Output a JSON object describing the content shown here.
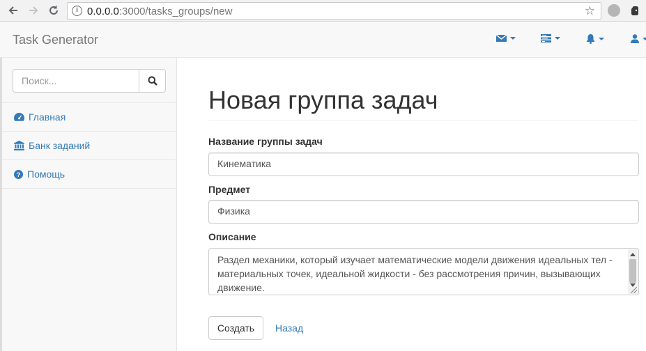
{
  "browser": {
    "url_host": "0.0.0.0",
    "url_rest": ":3000/tasks_groups/new"
  },
  "navbar": {
    "brand": "Task Generator",
    "menus": [
      {
        "icon": "envelope-icon"
      },
      {
        "icon": "tasks-icon"
      },
      {
        "icon": "bell-icon"
      },
      {
        "icon": "user-icon"
      }
    ]
  },
  "sidebar": {
    "search_placeholder": "Поиск...",
    "items": [
      {
        "label": "Главная",
        "icon": "dashboard-icon"
      },
      {
        "label": "Банк заданий",
        "icon": "bank-icon"
      },
      {
        "label": "Помощь",
        "icon": "question-circle-icon"
      }
    ]
  },
  "main": {
    "title": "Новая группа задач",
    "name_label": "Название группы задач",
    "name_value": "Кинематика",
    "subject_label": "Предмет",
    "subject_value": "Физика",
    "description_label": "Описание",
    "description_value": "Раздел механики, который изучает математические модели движения идеальных тел - материальных точек, идеальной жидкости - без рассмотрения причин, вызывающих движение.",
    "submit_label": "Создать",
    "back_label": "Назад"
  },
  "colors": {
    "link": "#337ab7",
    "navbar_bg": "#f8f8f8"
  }
}
